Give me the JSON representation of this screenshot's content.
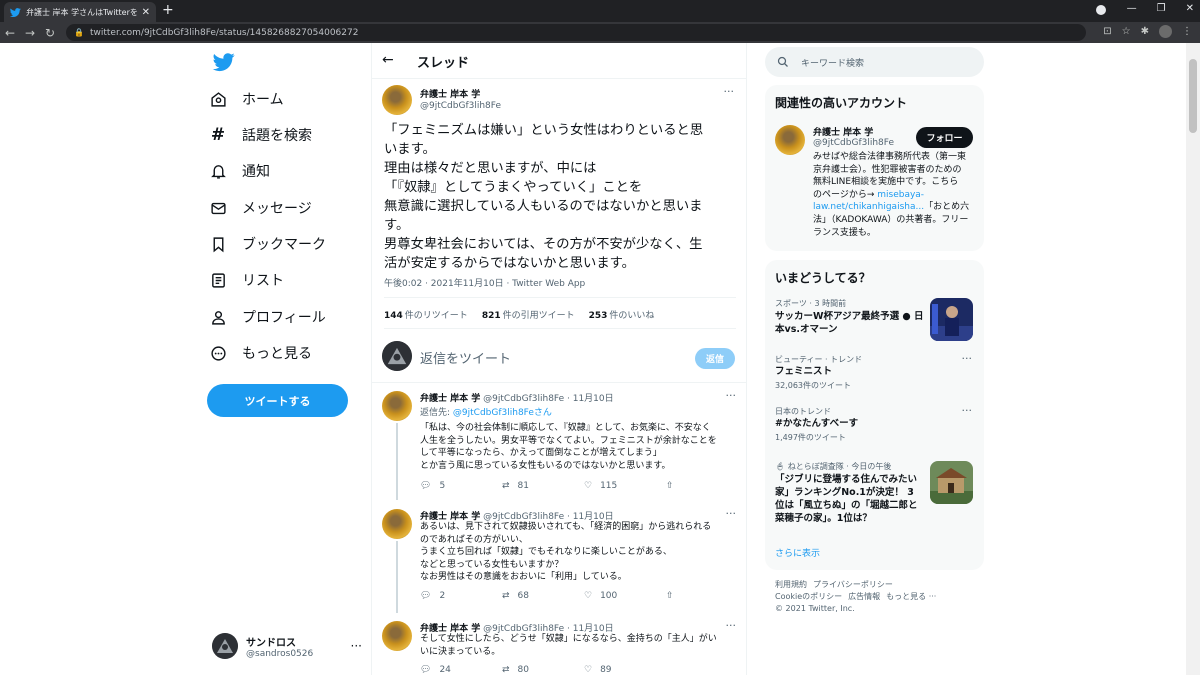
{
  "browser": {
    "tab_title": "弁護士 岸本 学さんはTwitterを使っています",
    "tab_close": "✕",
    "new_tab": "+",
    "url": "twitter.com/9jtCdbGf3lih8Fe/status/1458268827054006272",
    "win_min": "—",
    "win_max": "❐",
    "win_close": "✕"
  },
  "nav": {
    "items": [
      {
        "label": "ホーム",
        "icon": "home-icon"
      },
      {
        "label": "話題を検索",
        "icon": "hashtag-icon"
      },
      {
        "label": "通知",
        "icon": "bell-icon"
      },
      {
        "label": "メッセージ",
        "icon": "mail-icon"
      },
      {
        "label": "ブックマーク",
        "icon": "bookmark-icon"
      },
      {
        "label": "リスト",
        "icon": "list-icon"
      },
      {
        "label": "プロフィール",
        "icon": "profile-icon"
      },
      {
        "label": "もっと見る",
        "icon": "more-circle-icon"
      }
    ],
    "tweet_button": "ツイートする",
    "account": {
      "name": "サンドロス",
      "handle": "@sandros0526",
      "more": "···"
    }
  },
  "main": {
    "header_title": "スレッド",
    "tweet": {
      "name": "弁護士 岸本 学",
      "handle": "@9jtCdbGf3lih8Fe",
      "more": "···",
      "lines": [
        "「フェミニズムは嫌い」という女性はわりといると思",
        "います。",
        "理由は様々だと思いますが、中には",
        "「『奴隷』としてうまくやっていく」ことを",
        "無意識に選択している人もいるのではないかと思いま",
        "す。",
        "男尊女卑社会においては、その方が不安が少なく、生",
        "活が安定するからではないかと思います。"
      ],
      "meta": "午後0:02 · 2021年11月10日 · Twitter Web App",
      "retweets": "144",
      "retweets_label": "件のリツイート",
      "quotes": "821",
      "quotes_label": "件の引用ツイート",
      "likes": "253",
      "likes_label": "件のいいね"
    },
    "reply_box": {
      "placeholder": "返信をツイート",
      "button": "返信"
    },
    "replies": [
      {
        "name": "弁護士 岸本 学",
        "handle": "@9jtCdbGf3lih8Fe · 11月10日",
        "reply_to_label": "返信先: ",
        "reply_to_handle": "@9jtCdbGf3lih8Feさん",
        "lines": [
          "「私は、今の社会体制に順応して、『奴隷』として、お気楽に、不安なく",
          "人生を全うしたい。男女平等でなくてよい。フェミニストが余計なことを",
          "して平等になったら、かえって面倒なことが増えてしまう」",
          "とか言う風に思っている女性もいるのではないかと思います。"
        ],
        "reply_count": "5",
        "retweet_count": "81",
        "like_count": "115"
      },
      {
        "name": "弁護士 岸本 学",
        "handle": "@9jtCdbGf3lih8Fe · 11月10日",
        "lines": [
          "あるいは、見下されて奴隷扱いされても、「経済的困窮」から逃れられる",
          "のであればその方がいい、",
          "うまく立ち回れば「奴隷」でもそれなりに楽しいことがある、",
          "などと思っている女性もいますか？",
          "なお男性はその意識をおおいに「利用」している。"
        ],
        "reply_count": "2",
        "retweet_count": "68",
        "like_count": "100"
      },
      {
        "name": "弁護士 岸本 学",
        "handle": "@9jtCdbGf3lih8Fe · 11月10日",
        "lines": [
          "そして女性にしたら、どうせ「奴隷」になるなら、金持ちの「主人」がい",
          "いに決まっている。"
        ],
        "reply_count": "24",
        "retweet_count": "80",
        "like_count": "89"
      }
    ]
  },
  "right": {
    "search_placeholder": "キーワード検索",
    "related": {
      "title": "関連性の高いアカウント",
      "name": "弁護士 岸本 学",
      "handle": "@9jtCdbGf3lih8Fe",
      "follow": "フォロー",
      "bio_lines": [
        "みせばや総合法律事務所代表（第一東",
        "京弁護士会）。性犯罪被害者のための",
        "無料LINE相談を実施中です。こちら",
        "のページから→ ",
        "law.net/chikanhigaisha...",
        "法」（KADOKAWA）の共著者。フリー",
        "ランス支援も。"
      ],
      "bio_link_1": "misebaya-",
      "bio_after_link": "「おとめ六"
    },
    "trends": {
      "title": "いまどうしてる？",
      "items": [
        {
          "context": "スポーツ · 3 時間前",
          "title_lines": [
            "サッカーW杯アジア最終予選 ● 日",
            "本vs.オマーン"
          ],
          "has_image": true
        },
        {
          "context": "ビューティー · トレンド",
          "title_lines": [
            "フェミニスト"
          ],
          "count": "32,063件のツイート"
        },
        {
          "context": "日本のトレンド",
          "title_lines": [
            "#かなたんすべーす"
          ],
          "count": "1,497件のツイート"
        },
        {
          "context": "ねとらぼ調査隊 · 今日の午後",
          "title_lines": [
            "「ジブリに登場する住んでみたい",
            "家」ランキングNo.1が決定！ 3",
            "位は「風立ちぬ」の「堀越二郎と",
            "菜穂子の家」。1位は？"
          ],
          "has_image": true
        }
      ],
      "show_more": "さらに表示",
      "more": "···"
    },
    "footer": {
      "terms": "利用規約",
      "privacy": "プライバシーポリシー",
      "cookies": "Cookieのポリシー",
      "ads": "広告情報",
      "more": "もっと見る ···",
      "copyright": "© 2021 Twitter, Inc."
    }
  },
  "colors": {
    "accent": "#1d9bf0",
    "text": "#0f1419",
    "muted": "#536471",
    "border": "#eff3f4"
  }
}
